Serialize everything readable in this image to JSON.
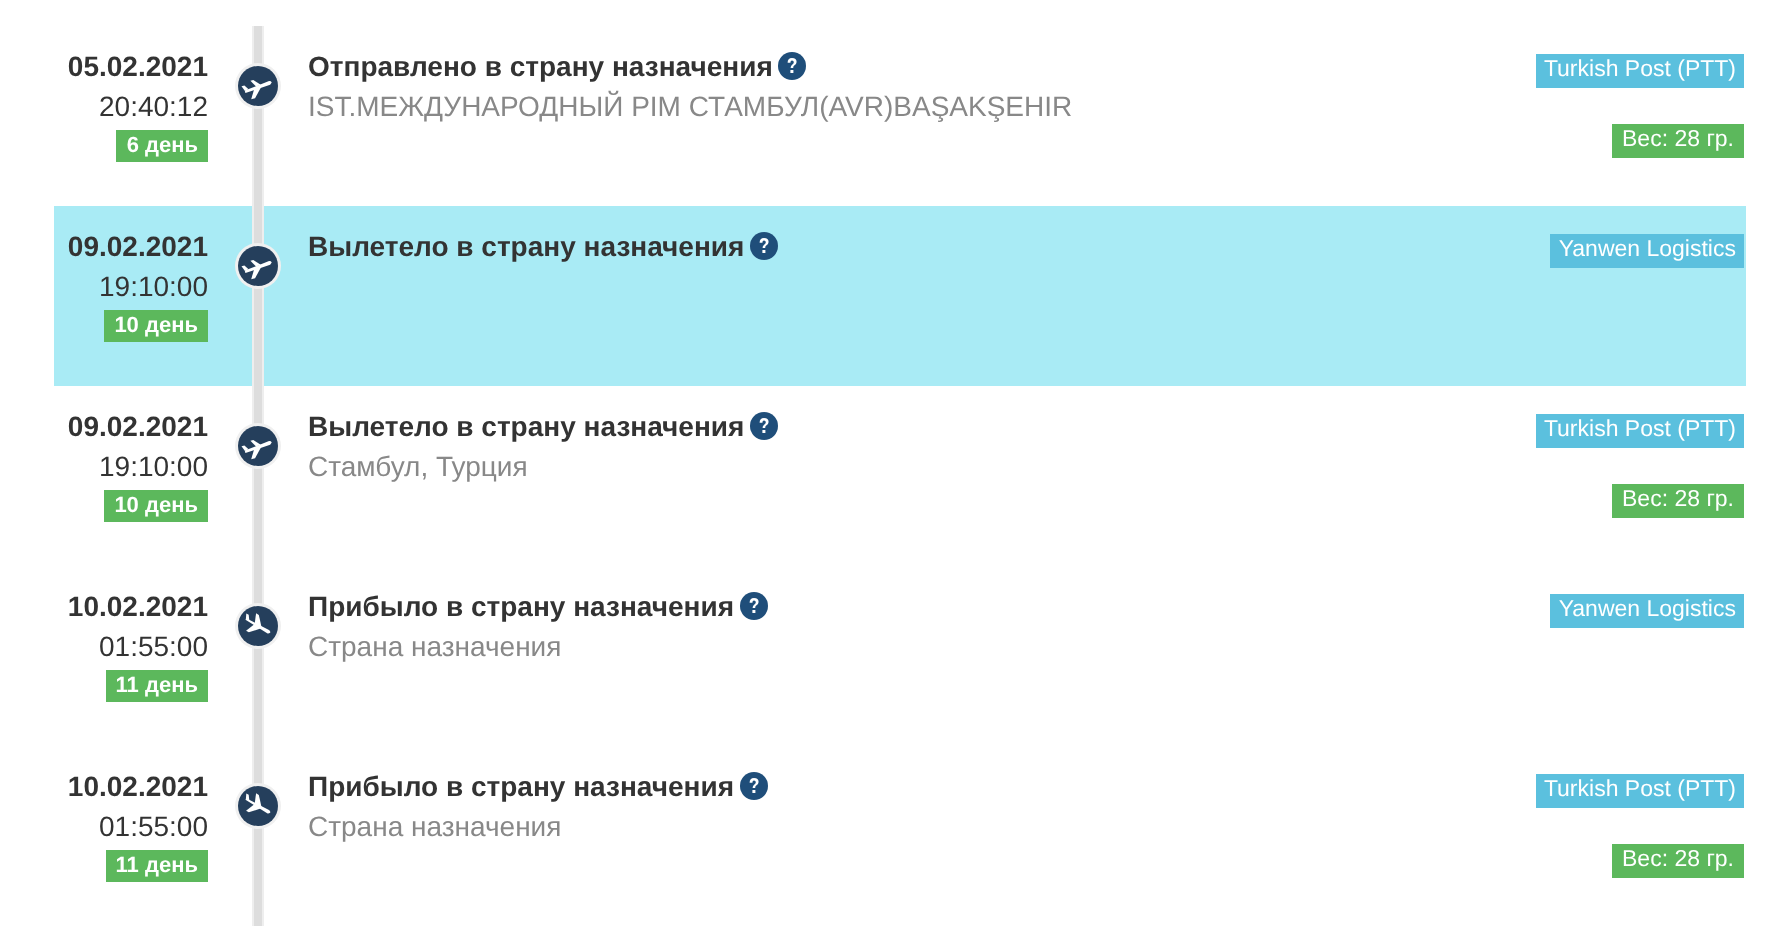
{
  "events": [
    {
      "date": "05.02.2021",
      "time": "20:40:12",
      "day": "6 день",
      "status": "Отправлено в страну назначения",
      "location": "IST.МЕЖДУНАРОДНЫЙ PIM СТАМБУЛ(AVR)BAŞAKŞEHIR",
      "kind": "departure",
      "carrier": "Turkish Post (PTT)",
      "weight": "Вес: 28 гр.",
      "selected": false
    },
    {
      "date": "09.02.2021",
      "time": "19:10:00",
      "day": "10 день",
      "status": "Вылетело в страну назначения",
      "kind": "departure",
      "carrier": "Yanwen Logistics",
      "selected": true
    },
    {
      "date": "09.02.2021",
      "time": "19:10:00",
      "day": "10 день",
      "status": "Вылетело в страну назначения",
      "location": "Стамбул, Турция",
      "kind": "departure",
      "carrier": "Turkish Post (PTT)",
      "weight": "Вес: 28 гр.",
      "selected": false
    },
    {
      "date": "10.02.2021",
      "time": "01:55:00",
      "day": "11 день",
      "status": "Прибыло в страну назначения",
      "location": "Страна назначения",
      "kind": "arrival",
      "carrier": "Yanwen Logistics",
      "selected": false
    },
    {
      "date": "10.02.2021",
      "time": "01:55:00",
      "day": "11 день",
      "status": "Прибыло в страну назначения",
      "location": "Страна назначения",
      "kind": "arrival",
      "carrier": "Turkish Post (PTT)",
      "weight": "Вес: 28 гр.",
      "selected": false
    }
  ]
}
